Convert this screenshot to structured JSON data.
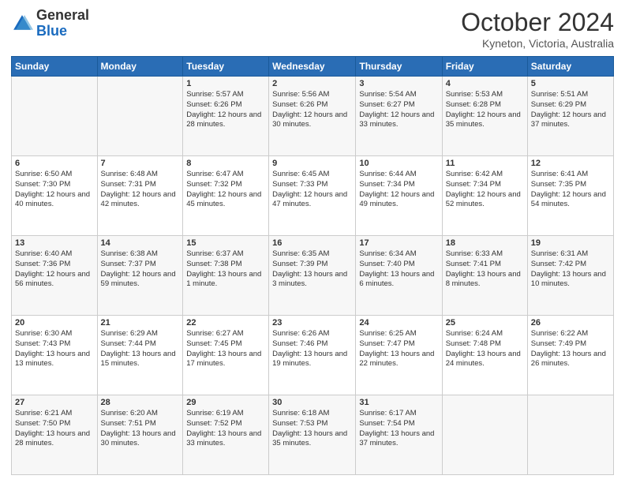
{
  "header": {
    "logo": {
      "line1": "General",
      "line2": "Blue"
    },
    "title": "October 2024",
    "subtitle": "Kyneton, Victoria, Australia"
  },
  "days_of_week": [
    "Sunday",
    "Monday",
    "Tuesday",
    "Wednesday",
    "Thursday",
    "Friday",
    "Saturday"
  ],
  "weeks": [
    [
      {
        "day": "",
        "info": ""
      },
      {
        "day": "",
        "info": ""
      },
      {
        "day": "1",
        "info": "Sunrise: 5:57 AM\nSunset: 6:26 PM\nDaylight: 12 hours and 28 minutes."
      },
      {
        "day": "2",
        "info": "Sunrise: 5:56 AM\nSunset: 6:26 PM\nDaylight: 12 hours and 30 minutes."
      },
      {
        "day": "3",
        "info": "Sunrise: 5:54 AM\nSunset: 6:27 PM\nDaylight: 12 hours and 33 minutes."
      },
      {
        "day": "4",
        "info": "Sunrise: 5:53 AM\nSunset: 6:28 PM\nDaylight: 12 hours and 35 minutes."
      },
      {
        "day": "5",
        "info": "Sunrise: 5:51 AM\nSunset: 6:29 PM\nDaylight: 12 hours and 37 minutes."
      }
    ],
    [
      {
        "day": "6",
        "info": "Sunrise: 6:50 AM\nSunset: 7:30 PM\nDaylight: 12 hours and 40 minutes."
      },
      {
        "day": "7",
        "info": "Sunrise: 6:48 AM\nSunset: 7:31 PM\nDaylight: 12 hours and 42 minutes."
      },
      {
        "day": "8",
        "info": "Sunrise: 6:47 AM\nSunset: 7:32 PM\nDaylight: 12 hours and 45 minutes."
      },
      {
        "day": "9",
        "info": "Sunrise: 6:45 AM\nSunset: 7:33 PM\nDaylight: 12 hours and 47 minutes."
      },
      {
        "day": "10",
        "info": "Sunrise: 6:44 AM\nSunset: 7:34 PM\nDaylight: 12 hours and 49 minutes."
      },
      {
        "day": "11",
        "info": "Sunrise: 6:42 AM\nSunset: 7:34 PM\nDaylight: 12 hours and 52 minutes."
      },
      {
        "day": "12",
        "info": "Sunrise: 6:41 AM\nSunset: 7:35 PM\nDaylight: 12 hours and 54 minutes."
      }
    ],
    [
      {
        "day": "13",
        "info": "Sunrise: 6:40 AM\nSunset: 7:36 PM\nDaylight: 12 hours and 56 minutes."
      },
      {
        "day": "14",
        "info": "Sunrise: 6:38 AM\nSunset: 7:37 PM\nDaylight: 12 hours and 59 minutes."
      },
      {
        "day": "15",
        "info": "Sunrise: 6:37 AM\nSunset: 7:38 PM\nDaylight: 13 hours and 1 minute."
      },
      {
        "day": "16",
        "info": "Sunrise: 6:35 AM\nSunset: 7:39 PM\nDaylight: 13 hours and 3 minutes."
      },
      {
        "day": "17",
        "info": "Sunrise: 6:34 AM\nSunset: 7:40 PM\nDaylight: 13 hours and 6 minutes."
      },
      {
        "day": "18",
        "info": "Sunrise: 6:33 AM\nSunset: 7:41 PM\nDaylight: 13 hours and 8 minutes."
      },
      {
        "day": "19",
        "info": "Sunrise: 6:31 AM\nSunset: 7:42 PM\nDaylight: 13 hours and 10 minutes."
      }
    ],
    [
      {
        "day": "20",
        "info": "Sunrise: 6:30 AM\nSunset: 7:43 PM\nDaylight: 13 hours and 13 minutes."
      },
      {
        "day": "21",
        "info": "Sunrise: 6:29 AM\nSunset: 7:44 PM\nDaylight: 13 hours and 15 minutes."
      },
      {
        "day": "22",
        "info": "Sunrise: 6:27 AM\nSunset: 7:45 PM\nDaylight: 13 hours and 17 minutes."
      },
      {
        "day": "23",
        "info": "Sunrise: 6:26 AM\nSunset: 7:46 PM\nDaylight: 13 hours and 19 minutes."
      },
      {
        "day": "24",
        "info": "Sunrise: 6:25 AM\nSunset: 7:47 PM\nDaylight: 13 hours and 22 minutes."
      },
      {
        "day": "25",
        "info": "Sunrise: 6:24 AM\nSunset: 7:48 PM\nDaylight: 13 hours and 24 minutes."
      },
      {
        "day": "26",
        "info": "Sunrise: 6:22 AM\nSunset: 7:49 PM\nDaylight: 13 hours and 26 minutes."
      }
    ],
    [
      {
        "day": "27",
        "info": "Sunrise: 6:21 AM\nSunset: 7:50 PM\nDaylight: 13 hours and 28 minutes."
      },
      {
        "day": "28",
        "info": "Sunrise: 6:20 AM\nSunset: 7:51 PM\nDaylight: 13 hours and 30 minutes."
      },
      {
        "day": "29",
        "info": "Sunrise: 6:19 AM\nSunset: 7:52 PM\nDaylight: 13 hours and 33 minutes."
      },
      {
        "day": "30",
        "info": "Sunrise: 6:18 AM\nSunset: 7:53 PM\nDaylight: 13 hours and 35 minutes."
      },
      {
        "day": "31",
        "info": "Sunrise: 6:17 AM\nSunset: 7:54 PM\nDaylight: 13 hours and 37 minutes."
      },
      {
        "day": "",
        "info": ""
      },
      {
        "day": "",
        "info": ""
      }
    ]
  ]
}
